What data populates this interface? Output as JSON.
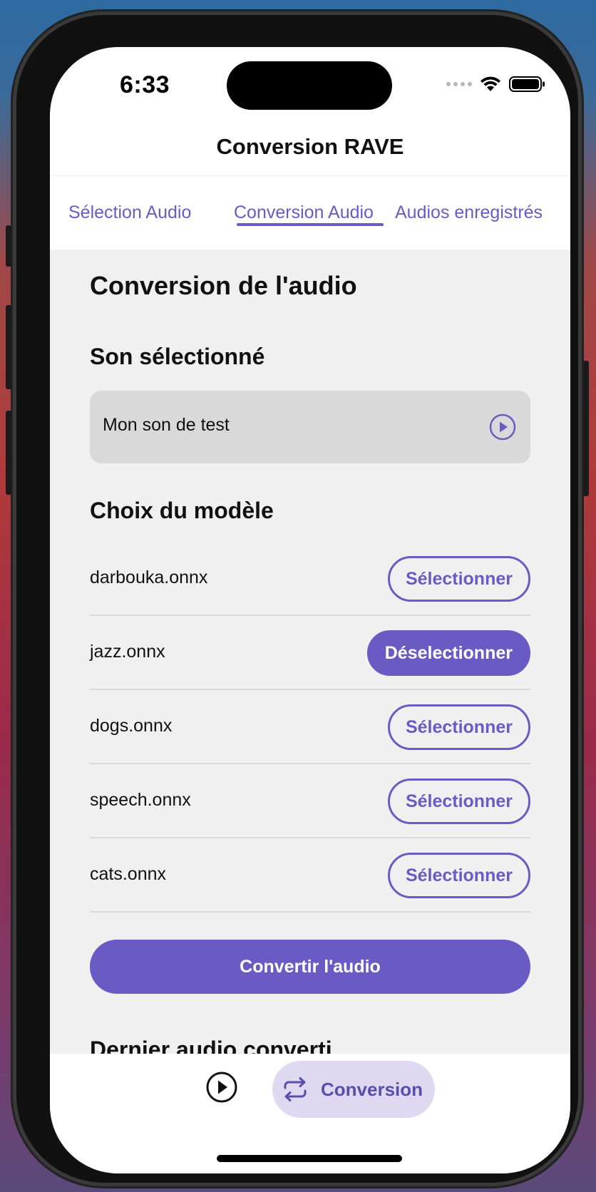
{
  "status": {
    "time": "6:33"
  },
  "nav": {
    "title": "Conversion RAVE"
  },
  "tabs": [
    {
      "label": "Sélection Audio",
      "active": false
    },
    {
      "label": "Conversion Audio",
      "active": true
    },
    {
      "label": "Audios enregistrés",
      "active": false
    }
  ],
  "main": {
    "heading": "Conversion de l'audio",
    "selected_sound_heading": "Son sélectionné",
    "selected_sound_name": "Mon son de test",
    "model_heading": "Choix du modèle",
    "models": [
      {
        "name": "darbouka.onnx",
        "action": "Sélectionner",
        "selected": false
      },
      {
        "name": "jazz.onnx",
        "action": "Déselectionner",
        "selected": true
      },
      {
        "name": "dogs.onnx",
        "action": "Sélectionner",
        "selected": false
      },
      {
        "name": "speech.onnx",
        "action": "Sélectionner",
        "selected": false
      },
      {
        "name": "cats.onnx",
        "action": "Sélectionner",
        "selected": false
      }
    ],
    "convert_button": "Convertir l'audio",
    "last_converted_heading": "Dernier audio converti"
  },
  "bottom_nav": {
    "items": [
      {
        "icon": "play-circle-icon"
      },
      {
        "icon": "repeat-icon",
        "label": "Conversion",
        "active": true
      }
    ]
  },
  "colors": {
    "accent": "#6a5bc4",
    "accent_light": "#ded9f1",
    "content_bg": "#f0f0f0"
  }
}
